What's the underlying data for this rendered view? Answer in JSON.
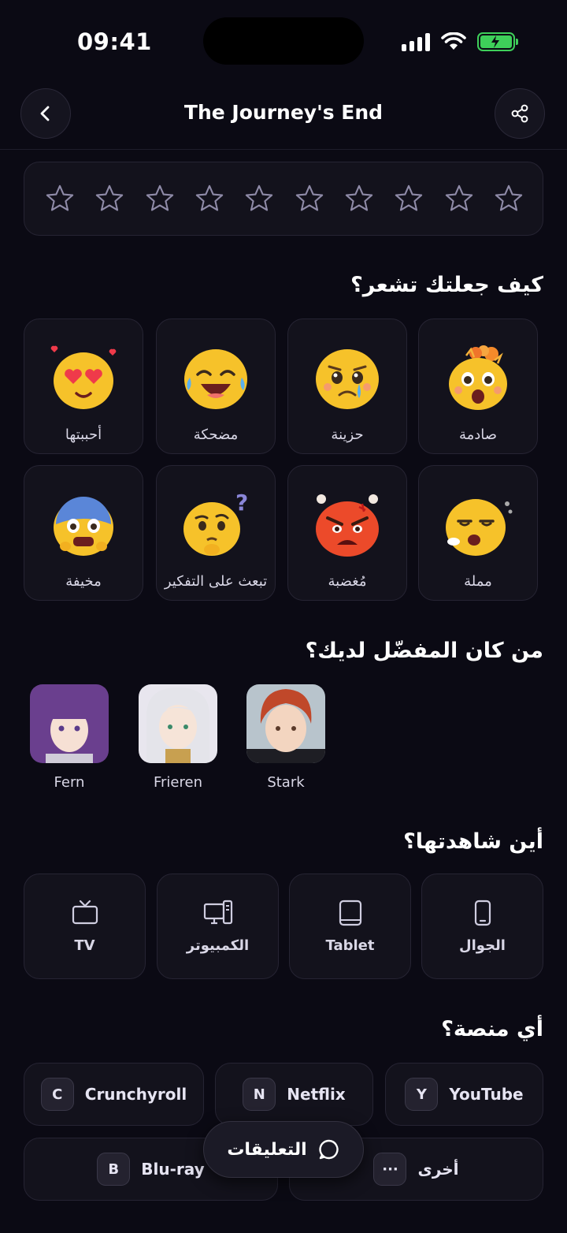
{
  "status_bar": {
    "time": "09:41"
  },
  "header": {
    "title": "The Journey's End"
  },
  "rating": {
    "max_stars": 10,
    "value": 0
  },
  "moods": {
    "title": "كيف جعلتك تشعر؟",
    "items": [
      {
        "label": "صادمة",
        "icon": "shocked-emoji-icon"
      },
      {
        "label": "حزينة",
        "icon": "sad-emoji-icon"
      },
      {
        "label": "مضحكة",
        "icon": "laughing-emoji-icon"
      },
      {
        "label": "أحببتها",
        "icon": "heart-eyes-emoji-icon"
      },
      {
        "label": "مملة",
        "icon": "bored-emoji-icon"
      },
      {
        "label": "مُغضبة",
        "icon": "angry-emoji-icon"
      },
      {
        "label": "تبعث على التفكير",
        "icon": "thinking-emoji-icon"
      },
      {
        "label": "مخيفة",
        "icon": "scared-emoji-icon"
      }
    ]
  },
  "favorites": {
    "title": "من كان المفضّل لديك؟",
    "characters": [
      {
        "name": "Stark",
        "hair": "#c0482a"
      },
      {
        "name": "Frieren",
        "hair": "#e4e4ea"
      },
      {
        "name": "Fern",
        "hair": "#6a3f8e"
      }
    ]
  },
  "watched_on": {
    "title": "أين شاهدتها؟",
    "options": [
      {
        "label": "الجوال",
        "icon": "phone-icon"
      },
      {
        "label": "Tablet",
        "icon": "tablet-icon"
      },
      {
        "label": "الكمبيوتر",
        "icon": "computer-icon"
      },
      {
        "label": "TV",
        "icon": "tv-icon"
      }
    ]
  },
  "platforms": {
    "title": "أي منصة؟",
    "items": [
      {
        "badge": "Y",
        "label": "YouTube"
      },
      {
        "badge": "N",
        "label": "Netflix"
      },
      {
        "badge": "C",
        "label": "Crunchyroll"
      },
      {
        "badge": "···",
        "label": "أخرى"
      },
      {
        "badge": "B",
        "label": "Blu-ray"
      }
    ]
  },
  "comments_button": {
    "label": "التعليقات"
  },
  "colors": {
    "background": "#0b0a14",
    "card": "#13121c",
    "battery": "#3ecf5a"
  }
}
